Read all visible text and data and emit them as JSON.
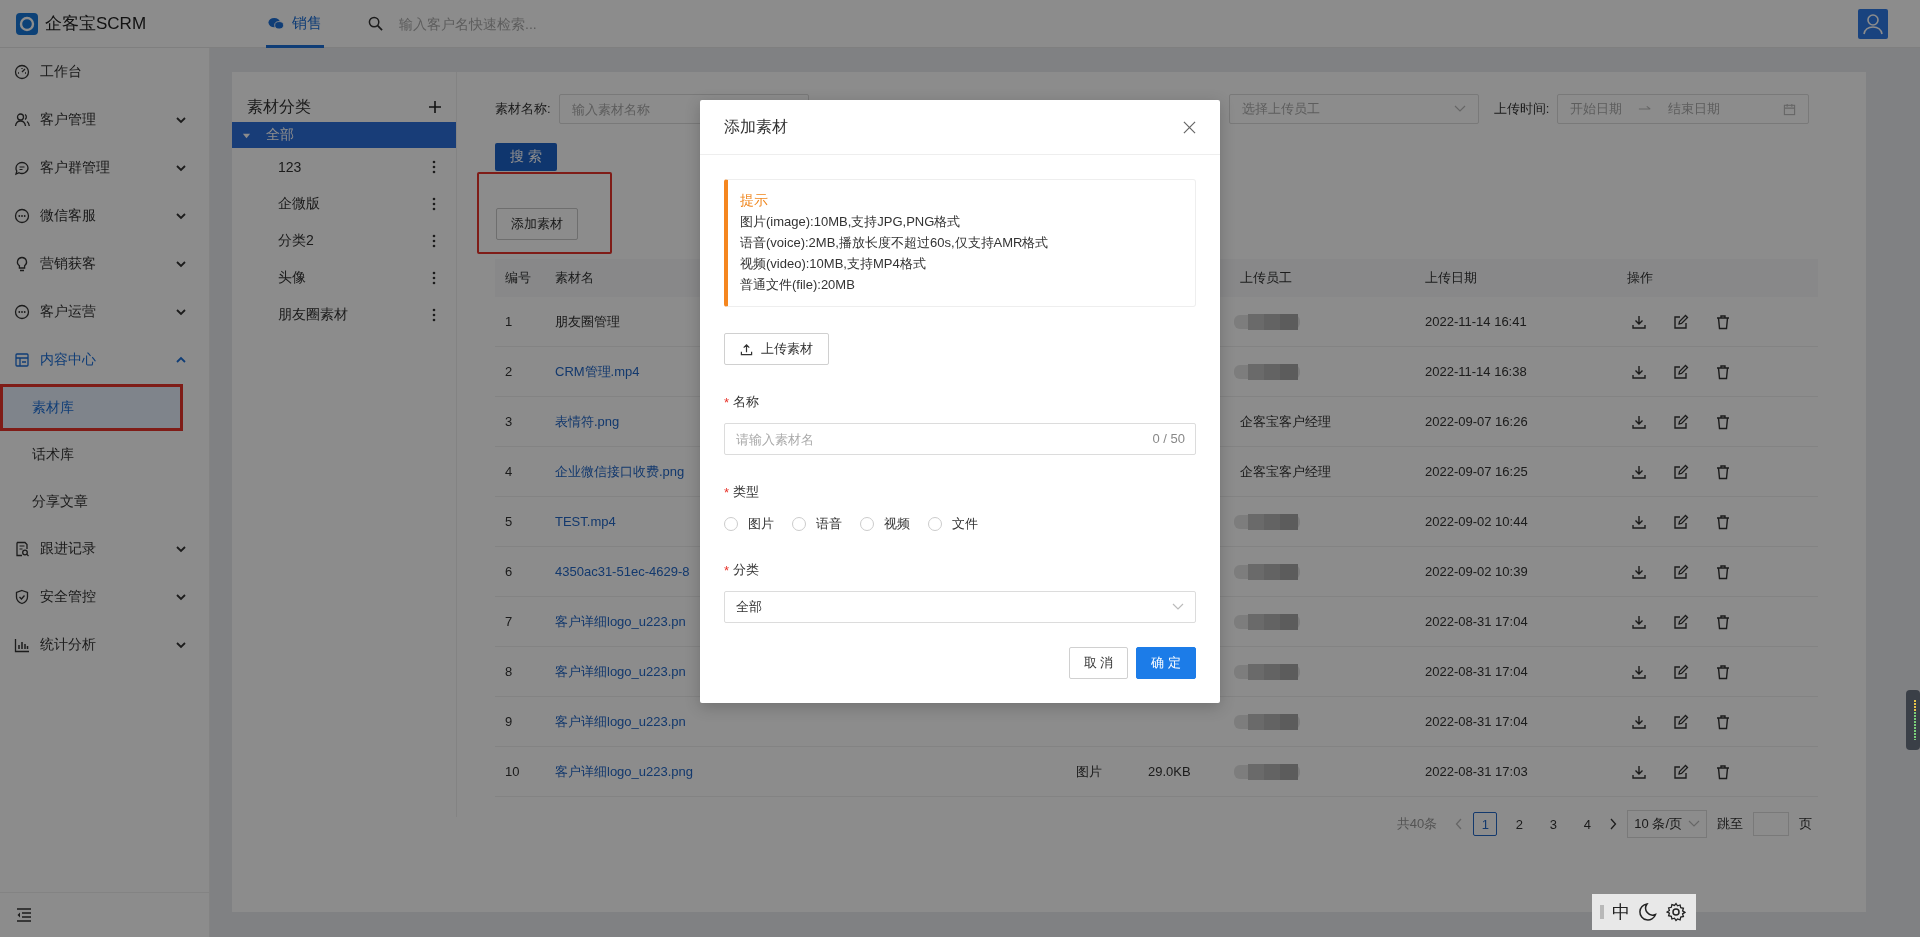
{
  "header": {
    "brand": "企客宝SCRM",
    "tabs": [
      {
        "label": "销售",
        "selected": true
      }
    ],
    "search": {
      "placeholder": "输入客户名快速检索..."
    }
  },
  "sidebar": {
    "items": [
      {
        "label": "工作台",
        "selected": false
      },
      {
        "label": "客户管理",
        "selected": false,
        "expanded": false
      },
      {
        "label": "客户群管理",
        "selected": false,
        "expanded": false
      },
      {
        "label": "微信客服",
        "selected": false,
        "expanded": false
      },
      {
        "label": "营销获客",
        "selected": false,
        "expanded": false
      },
      {
        "label": "客户运营",
        "selected": false,
        "expanded": false
      },
      {
        "label": "内容中心",
        "selected": true,
        "expanded": true,
        "children": [
          {
            "label": "素材库",
            "selected": true,
            "highlighted": true
          },
          {
            "label": "话术库",
            "selected": false,
            "highlighted": false
          },
          {
            "label": "分享文章",
            "selected": false,
            "highlighted": false
          }
        ]
      },
      {
        "label": "跟进记录",
        "selected": false,
        "expanded": false
      },
      {
        "label": "安全管控",
        "selected": false,
        "expanded": false
      },
      {
        "label": "统计分析",
        "selected": false,
        "expanded": false
      }
    ]
  },
  "categories": {
    "title": "素材分类",
    "items": [
      {
        "label": "全部",
        "selected": true,
        "expanded": true,
        "children": [
          {
            "label": "123",
            "selected": false
          },
          {
            "label": "企微版",
            "selected": false
          },
          {
            "label": "分类2",
            "selected": false
          },
          {
            "label": "头像",
            "selected": false
          },
          {
            "label": "朋友圈素材",
            "selected": false
          }
        ]
      }
    ]
  },
  "filters": [
    {
      "kind": "input",
      "label": "素材名称:",
      "placeholder": "输入素材名称"
    },
    {
      "kind": "select",
      "placeholder": "选择上传员工"
    },
    {
      "kind": "daterange",
      "label": "上传时间:",
      "start": "开始日期",
      "end": "结束日期"
    }
  ],
  "search_button": "搜 索",
  "add_button": {
    "label": "添加素材",
    "highlighted": true
  },
  "table": {
    "columns": [
      "编号",
      "素材名",
      "上传员工",
      "上传日期",
      "操作"
    ],
    "rows": [
      {
        "no": "1",
        "name": "朋友圈管理",
        "link": false,
        "redacted": true,
        "date": "2022-11-14 16:41"
      },
      {
        "no": "2",
        "name": "CRM管理.mp4",
        "link": true,
        "redacted": true,
        "date": "2022-11-14 16:38"
      },
      {
        "no": "3",
        "name": "表情符.png",
        "link": true,
        "uploader": "企客宝客户经理",
        "redacted": false,
        "date": "2022-09-07 16:26"
      },
      {
        "no": "4",
        "name": "企业微信接口收费.png",
        "link": true,
        "uploader": "企客宝客户经理",
        "redacted": false,
        "date": "2022-09-07 16:25"
      },
      {
        "no": "5",
        "name": "TEST.mp4",
        "link": true,
        "redacted": true,
        "date": "2022-09-02 10:44"
      },
      {
        "no": "6",
        "name": "4350ac31-51ec-4629-8",
        "link": true,
        "redacted": true,
        "date": "2022-09-02 10:39"
      },
      {
        "no": "7",
        "name": "客户详细logo_u223.pn",
        "link": true,
        "redacted": true,
        "date": "2022-08-31 17:04"
      },
      {
        "no": "8",
        "name": "客户详细logo_u223.pn",
        "link": true,
        "redacted": true,
        "date": "2022-08-31 17:04"
      },
      {
        "no": "9",
        "name": "客户详细logo_u223.pn",
        "link": true,
        "redacted": true,
        "date": "2022-08-31 17:04"
      },
      {
        "no": "10",
        "name": "客户详细logo_u223.png",
        "link": true,
        "type": "图片",
        "size": "29.0KB",
        "redacted": true,
        "date": "2022-08-31 17:03"
      }
    ]
  },
  "pagination": {
    "total": "共40条",
    "pages": [
      {
        "label": "1",
        "selected": true
      },
      {
        "label": "2",
        "selected": false
      },
      {
        "label": "3",
        "selected": false
      },
      {
        "label": "4",
        "selected": false
      }
    ],
    "page_size": "10 条/页",
    "jump_label": "跳至",
    "page_suffix": "页"
  },
  "modal": {
    "title": "添加素材",
    "tip": {
      "title": "提示",
      "lines": [
        "图片(image):10MB,支持JPG,PNG格式",
        "语音(voice):2MB,播放长度不超过60s,仅支持AMR格式",
        "视频(video):10MB,支持MP4格式",
        "普通文件(file):20MB"
      ]
    },
    "upload_button": "上传素材",
    "name_field": {
      "required_mark": "*",
      "label": "名称",
      "placeholder": "请输入素材名",
      "counter": "0 / 50"
    },
    "type_field": {
      "required_mark": "*",
      "label": "类型",
      "options": [
        {
          "label": "图片",
          "selected": false
        },
        {
          "label": "语音",
          "selected": false
        },
        {
          "label": "视频",
          "selected": false
        },
        {
          "label": "文件",
          "selected": false
        }
      ]
    },
    "category_field": {
      "required_mark": "*",
      "label": "分类",
      "value": "全部"
    },
    "buttons": [
      {
        "label": "取 消",
        "kind": "default"
      },
      {
        "label": "确 定",
        "kind": "primary"
      }
    ]
  },
  "float_toolbar": {
    "language": "中"
  }
}
